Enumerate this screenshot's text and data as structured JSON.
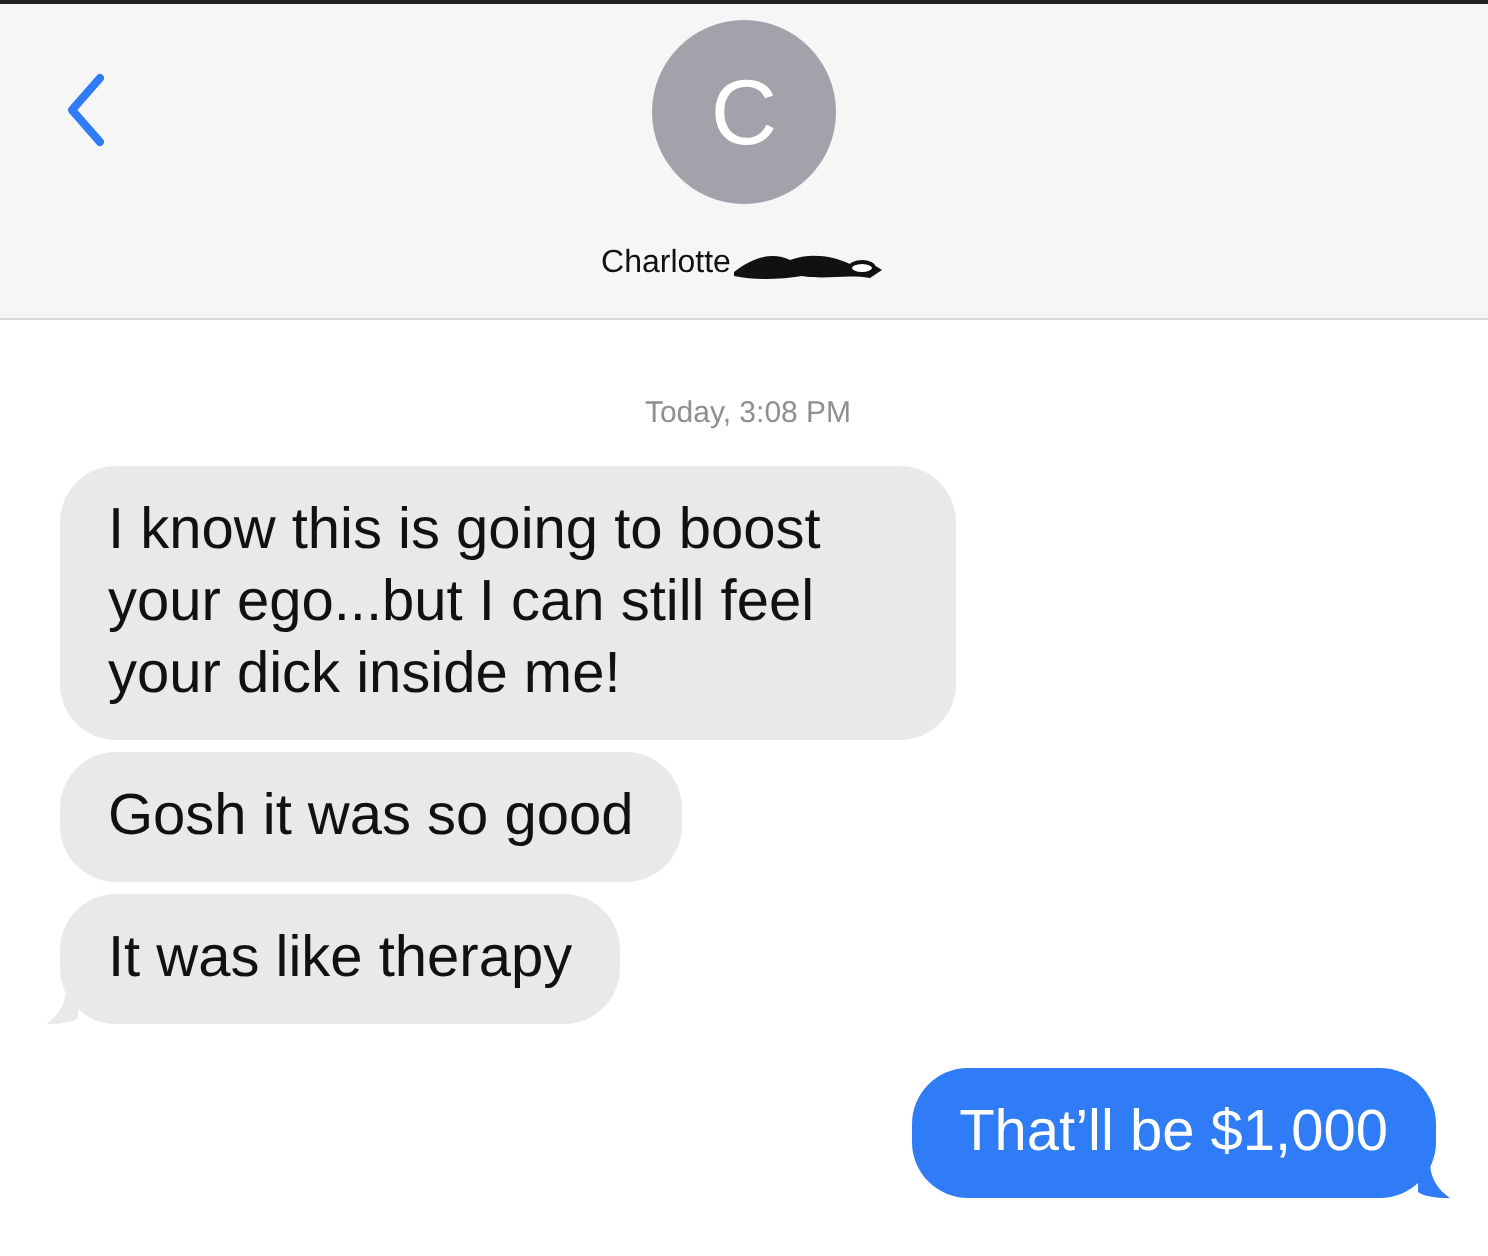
{
  "header": {
    "avatar_initial": "C",
    "name": "Charlotte"
  },
  "timestamp": "Today, 3:08 PM",
  "messages": [
    {
      "kind": "received",
      "tail": false,
      "text": "I know this is going to boost your ego...but I can still feel your dick inside me!"
    },
    {
      "kind": "received",
      "tail": false,
      "text": "Gosh it was so good"
    },
    {
      "kind": "received",
      "tail": true,
      "text": "It was like therapy"
    },
    {
      "kind": "sent",
      "tail": true,
      "text": "That’ll be $1,000"
    }
  ]
}
